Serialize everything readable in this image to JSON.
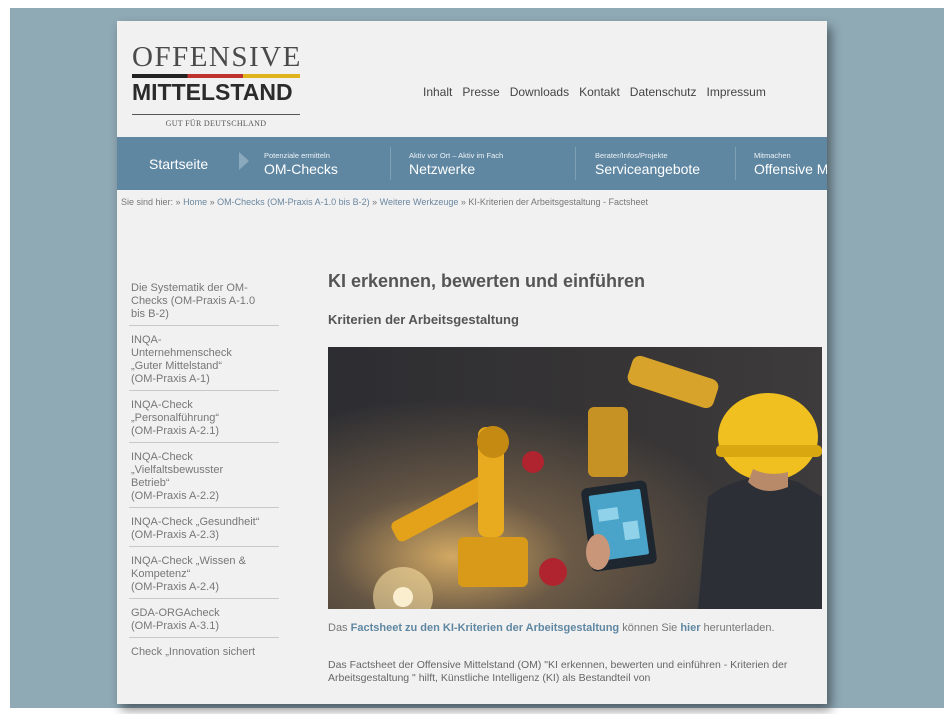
{
  "logo": {
    "top": "OFFENSIVE",
    "bottom": "MITTELSTAND",
    "tagline": "GUT FÜR DEUTSCHLAND"
  },
  "top_nav": [
    "Inhalt",
    "Presse",
    "Downloads",
    "Kontakt",
    "Datenschutz",
    "Impressum"
  ],
  "main_nav": {
    "start": "Startseite",
    "items": [
      {
        "small": "Potenziale ermitteln",
        "big": "OM-Checks"
      },
      {
        "small": "Aktiv vor Ort – Aktiv im Fach",
        "big": "Netzwerke"
      },
      {
        "small": "Berater/Infos/Projekte",
        "big": "Serviceangebote"
      },
      {
        "small": "Mitmachen",
        "big": "Offensive M"
      }
    ]
  },
  "breadcrumb": {
    "prefix": "Sie sind hier:",
    "items": [
      "Home",
      "OM-Checks (OM-Praxis A-1.0 bis B-2)",
      "Weitere Werkzeuge",
      "KI-Kriterien der Arbeitsgestaltung - Factsheet"
    ]
  },
  "sidebar": [
    "Die Systematik der OM-\nChecks (OM-Praxis A-1.0\nbis B-2)",
    "INQA-\nUnternehmenscheck\n„Guter Mittelstand“\n(OM-Praxis A-1)",
    "INQA-Check\n„Personalführung“\n(OM-Praxis A-2.1)",
    "INQA-Check\n„Vielfaltsbewusster\nBetrieb“\n(OM-Praxis A-2.2)",
    "INQA-Check „Gesundheit“\n(OM-Praxis A-2.3)",
    "INQA-Check „Wissen &\nKompetenz“\n(OM-Praxis A-2.4)",
    "GDA-ORGAcheck\n(OM-Praxis A-3.1)",
    "Check „Innovation sichert"
  ],
  "content": {
    "title": "KI erkennen, bewerten und einführen",
    "subtitle": "Kriterien der Arbeitsgestaltung",
    "p1_pre": "Das ",
    "p1_link": "Factsheet zu den KI-Kriterien der Arbeitsgestaltung",
    "p1_mid": " können Sie ",
    "p1_link2": "hier",
    "p1_post": " herunterladen.",
    "p2": "Das Factsheet der Offensive Mittelstand (OM) \"KI erkennen, bewerten und einführen - Kriterien der Arbeitsgestaltung \" hilft, Künstliche Intelligenz (KI) als Bestandteil von"
  },
  "colors": {
    "backdrop": "#8fa9b5",
    "nav": "#5f87a2",
    "link": "#5f87a2"
  }
}
